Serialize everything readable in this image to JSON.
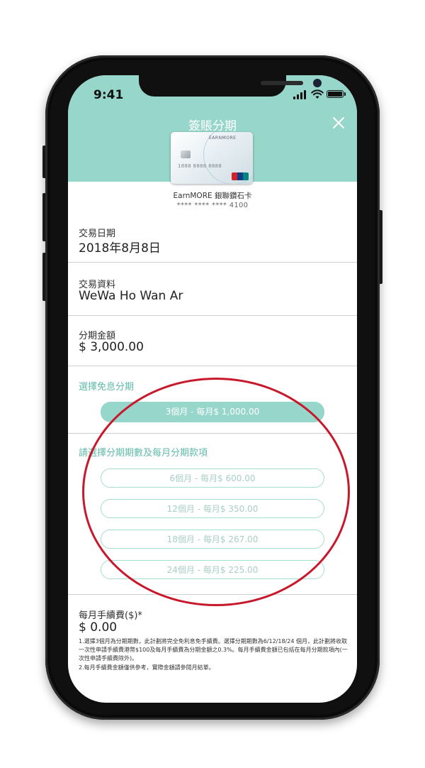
{
  "status_bar": {
    "time": "9:41"
  },
  "header": {
    "title": "簽賬分期",
    "close_icon": "close-icon"
  },
  "card": {
    "brand": "EARNMORE",
    "number": "1888 8888 8888",
    "name": "EarnMORE 銀聯鑽石卡",
    "masked_number": "**** **** **** 4100"
  },
  "fields": [
    {
      "label": "交易日期",
      "value": "2018年8月8日"
    },
    {
      "label": "交易資料",
      "value": "WeWa Ho Wan Ar"
    },
    {
      "label": "分期金額",
      "value": "$ 3,000.00"
    }
  ],
  "interest_free": {
    "label": "選擇免息分期",
    "option": "3個月 - 每月$ 1,000.00"
  },
  "installments": {
    "label": "請選擇分期期數及每月分期款項",
    "options": [
      "6個月 - 每月$ 600.00",
      "12個月 - 每月$ 350.00",
      "18個月 - 每月$ 267.00",
      "24個月 - 每月$ 225.00"
    ]
  },
  "fee": {
    "label": "每月手續費($)*",
    "value": "$ 0.00",
    "notes": [
      "1.選擇3個月為分期期數，此計劃將完全免利息免手續費。選擇分期期數為6/12/18/24 個月，此計劃將收取一次性申請手續費港幣$100及每月手續費為分期金額之0.3%。每月手續費金額已包括在每月分期款項內(一次性申請手續費除外)。",
      "2.每月手續費金額僅供參考，實際金額請參閱月結單。"
    ]
  },
  "colors": {
    "accent": "#97d6ca",
    "annotation": "#c8182c"
  }
}
